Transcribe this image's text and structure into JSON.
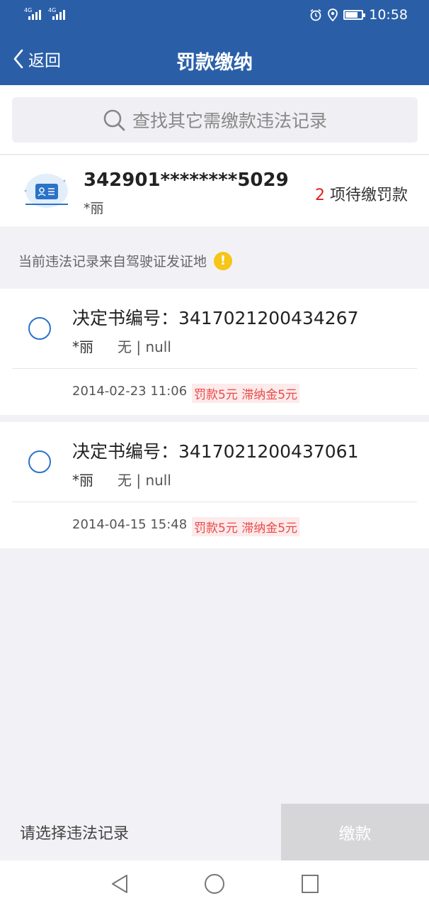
{
  "status_bar": {
    "network1": "4G",
    "network2": "4G",
    "time": "10:58",
    "battery_level": 0.75
  },
  "nav": {
    "back_label": "返回",
    "title": "罚款缴纳"
  },
  "search": {
    "placeholder": "查找其它需缴款违法记录"
  },
  "license": {
    "number": "342901********5029",
    "name": "*丽",
    "pending_count": "2",
    "pending_suffix": " 项待缴罚款"
  },
  "notice": {
    "text": "当前违法记录来自驾驶证发证地",
    "badge": "!"
  },
  "records": [
    {
      "decision_no": "决定书编号：3417021200434267",
      "owner": "*丽",
      "plate": "无 | null",
      "datetime": "2014-02-23 11:06",
      "fine": "罚款5元 滞纳金5元"
    },
    {
      "decision_no": "决定书编号：3417021200437061",
      "owner": "*丽",
      "plate": "无 | null",
      "datetime": "2014-04-15 15:48",
      "fine": "罚款5元 滞纳金5元"
    }
  ],
  "bottom": {
    "select_prompt": "请选择违法记录",
    "pay_label": "缴款"
  },
  "icons": {
    "back": "chevron-left-icon",
    "search": "search-icon",
    "license": "id-card-icon",
    "warning": "warning-icon"
  }
}
